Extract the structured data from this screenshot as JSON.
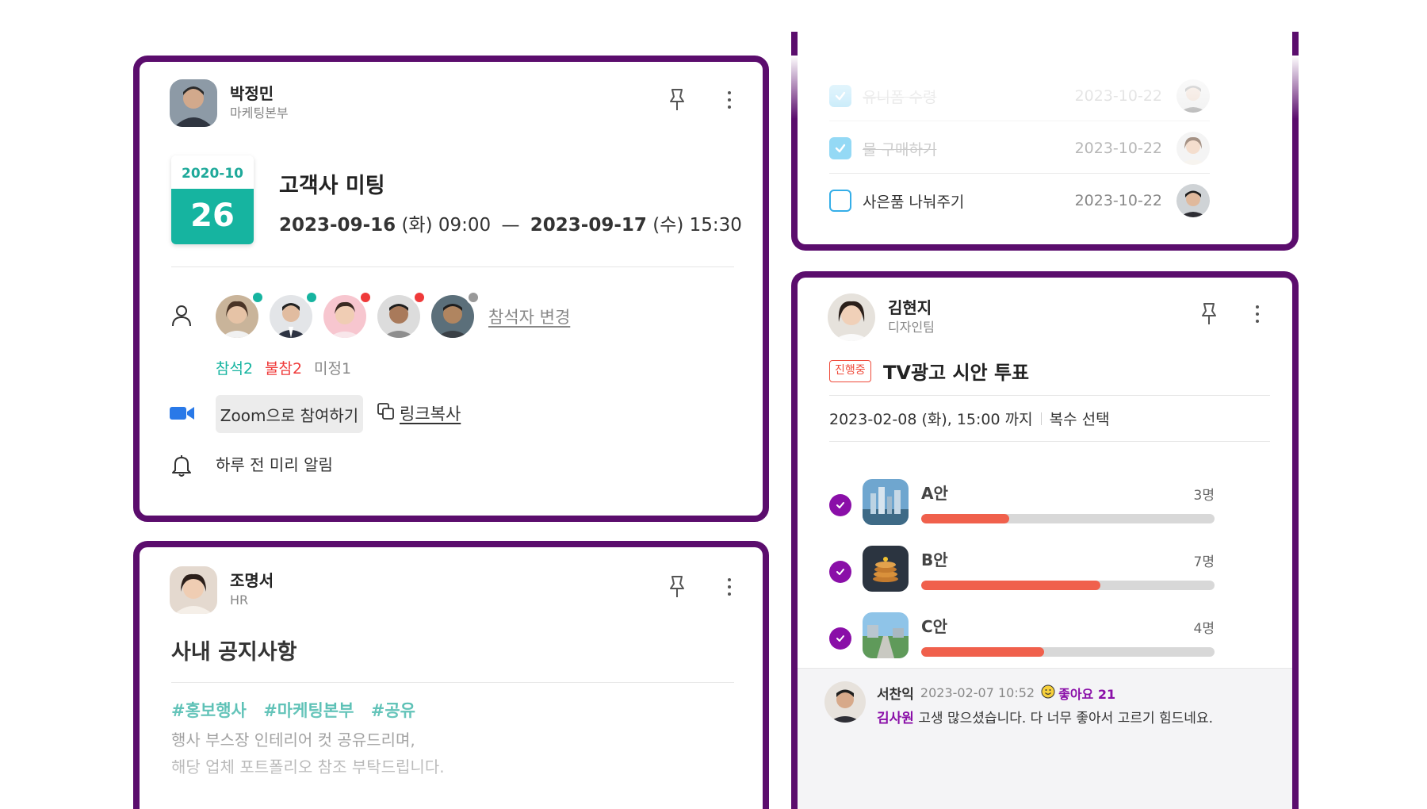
{
  "event_card": {
    "author_name": "박정민",
    "author_dept": "마케팅본부",
    "calendar_month": "2020-10",
    "calendar_day": "26",
    "title": "고객사 미팅",
    "start_date": "2023-09-16",
    "start_weekday": "(화)",
    "start_time": "09:00",
    "range_sep": "—",
    "end_date": "2023-09-17",
    "end_weekday": "(수)",
    "end_time": "15:30",
    "change_attendees_label": "참석자 변경",
    "attend_label": "참석2",
    "absent_label": "불참2",
    "undecided_label": "미정1",
    "zoom_button_label": "Zoom으로 참여하기",
    "copy_link_label": "링크복사",
    "reminder_label": "하루 전 미리 알림",
    "attendee_status_colors": [
      "#16b4a0",
      "#16b4a0",
      "#ef3a3a",
      "#ef3a3a",
      "#999999"
    ]
  },
  "notice_card": {
    "author_name": "조명서",
    "author_dept": "HR",
    "title": "사내 공지사항",
    "tags": [
      "#홍보행사",
      "#마케팅본부",
      "#공유"
    ],
    "body_line1": "행사 부스장 인테리어 컷 공유드리며,",
    "body_line2": "해당 업체 포트폴리오 참조 부탁드립니다."
  },
  "todo_card": {
    "items": [
      {
        "label": "유니폼 수령",
        "date": "2023-10-22",
        "done": true
      },
      {
        "label": "물 구매하기",
        "date": "2023-10-22",
        "done": true
      },
      {
        "label": "사은품 나눠주기",
        "date": "2023-10-22",
        "done": false
      }
    ]
  },
  "poll_card": {
    "author_name": "김현지",
    "author_dept": "디자인팀",
    "status_badge": "진행중",
    "title": "TV광고 시안 투표",
    "deadline": "2023-02-08 (화), 15:00 까지",
    "mode": "복수 선택",
    "options": [
      {
        "label": "A안",
        "count": "3명",
        "fraction": 0.3
      },
      {
        "label": "B안",
        "count": "7명",
        "fraction": 0.61
      },
      {
        "label": "C안",
        "count": "4명",
        "fraction": 0.42
      }
    ],
    "comment": {
      "author": "서찬익",
      "timestamp": "2023-02-07 10:52",
      "like_label": "좋아요 21",
      "mention": "김사원",
      "text": " 고생 많으셨습니다. 다 너무 좋아서 고르기 힘드네요."
    }
  },
  "colors": {
    "card_border": "#5b0d6d",
    "accent_teal": "#16b4a0",
    "accent_red": "#ef3a3a",
    "poll_purple": "#8a0fa8",
    "bar_fill": "#f0604c"
  }
}
